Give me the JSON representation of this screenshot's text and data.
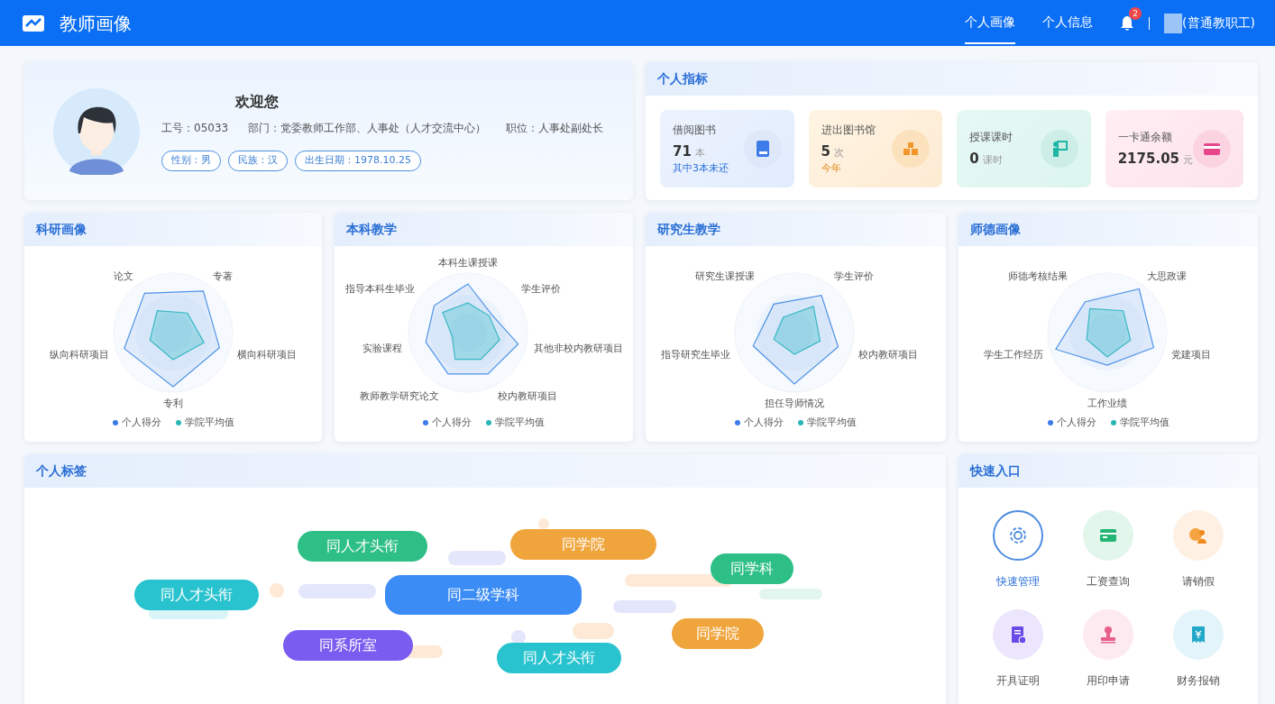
{
  "app": {
    "title": "教师画像"
  },
  "nav": [
    {
      "label": "个人画像",
      "selected": true
    },
    {
      "label": "个人信息",
      "selected": false
    }
  ],
  "notifications": {
    "count": "2"
  },
  "user": {
    "role": "(普通教职工)"
  },
  "profile": {
    "greeting": "欢迎您",
    "fields": [
      "工号：05033",
      "部门：党委教师工作部、人事处（人才交流中心）",
      "职位：人事处副处长"
    ],
    "tags": [
      "性别：男",
      "民族：汉",
      "出生日期：1978.10.25"
    ]
  },
  "indicators": {
    "title": "个人指标",
    "items": [
      {
        "kind": "book",
        "label": "借阅图书",
        "value": "71",
        "unit": "本",
        "note": "其中3本未还"
      },
      {
        "kind": "library",
        "label": "进出图书馆",
        "value": "5",
        "unit": "次",
        "note": "今年"
      },
      {
        "kind": "teach",
        "label": "授课课时",
        "value": "0",
        "unit": "课时"
      },
      {
        "kind": "card",
        "label": "一卡通余额",
        "value": "2175.05",
        "unit": "元"
      }
    ]
  },
  "radars": [
    {
      "title": "科研画像",
      "axes": [
        "论文",
        "专著",
        "纵向科研项目",
        "横向科研项目",
        "专利"
      ],
      "legend": [
        "个人得分",
        "学院平均值"
      ]
    },
    {
      "title": "本科教学",
      "axes": [
        "本科生课授课",
        "指导本科生毕业",
        "学生评价",
        "实验课程",
        "其他非校内教研项目",
        "教师教学研究论文",
        "校内教研项目"
      ],
      "legend": [
        "个人得分",
        "学院平均值"
      ]
    },
    {
      "title": "研究生教学",
      "axes": [
        "研究生课授课",
        "学生评价",
        "指导研究生毕业",
        "校内教研项目",
        "担任导师情况"
      ],
      "legend": [
        "个人得分",
        "学院平均值"
      ]
    },
    {
      "title": "师德画像",
      "axes": [
        "师德考核结果",
        "大思政课",
        "学生工作经历",
        "党建项目",
        "工作业绩"
      ],
      "legend": [
        "个人得分",
        "学院平均值"
      ]
    }
  ],
  "tags": {
    "title": "个人标签",
    "items": [
      {
        "label": "同人才头衔",
        "color": "#2dbf86"
      },
      {
        "label": "同学院",
        "color": "#f0a53c"
      },
      {
        "label": "同学科",
        "color": "#2dbf86"
      },
      {
        "label": "同人才头衔",
        "color": "#28c3cf"
      },
      {
        "label": "同二级学科",
        "color": "#3b8cf5"
      },
      {
        "label": "同学院",
        "color": "#f0a53c"
      },
      {
        "label": "同系所室",
        "color": "#7a5cf0"
      },
      {
        "label": "同人才头衔",
        "color": "#28c3cf"
      }
    ]
  },
  "quick": {
    "title": "快速入口",
    "items": [
      {
        "kind": "gear",
        "label": "快速管理",
        "selected": true
      },
      {
        "kind": "salary",
        "label": "工资查询",
        "selected": false
      },
      {
        "kind": "leave",
        "label": "请销假",
        "selected": false
      },
      {
        "kind": "certificate",
        "label": "开具证明",
        "selected": false
      },
      {
        "kind": "stamp",
        "label": "用印申请",
        "selected": false
      },
      {
        "kind": "receipt",
        "label": "财务报销",
        "selected": false
      }
    ]
  }
}
